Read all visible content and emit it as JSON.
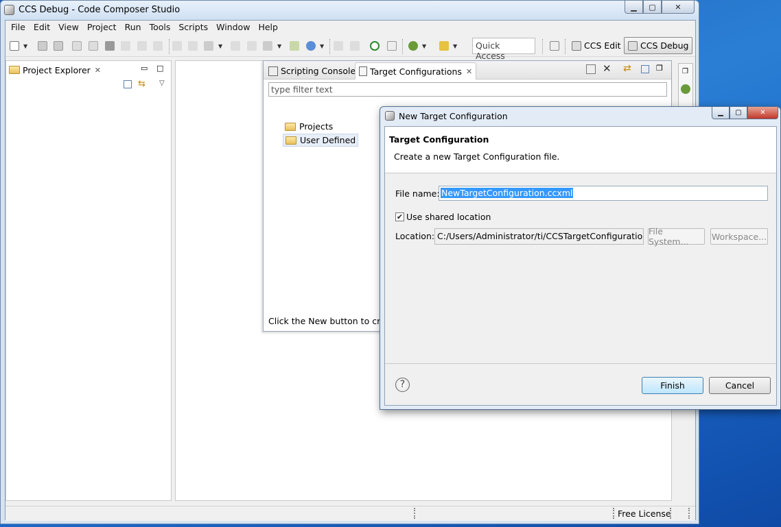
{
  "window": {
    "title": "CCS Debug - Code Composer Studio"
  },
  "menu": [
    "File",
    "Edit",
    "View",
    "Project",
    "Run",
    "Tools",
    "Scripts",
    "Window",
    "Help"
  ],
  "toolbar": {
    "quick_access_placeholder": "Quick Access",
    "perspective_edit": "CCS Edit",
    "perspective_debug": "CCS Debug"
  },
  "project_explorer": {
    "tab_label": "Project Explorer"
  },
  "target_config_panel": {
    "tab_scripting": "Scripting Console",
    "tab_target": "Target Configurations",
    "filter_placeholder": "type filter text",
    "tree": [
      "Projects",
      "User Defined"
    ],
    "hint": "Click the New button to crea"
  },
  "status": {
    "license": "Free License"
  },
  "dialog": {
    "title": "New Target Configuration",
    "header_title": "Target Configuration",
    "header_desc": "Create a new Target Configuration file.",
    "file_name_label": "File name:",
    "file_name_value": "NewTargetConfiguration.ccxml",
    "shared_location_label": "Use shared location",
    "shared_location_checked": true,
    "location_label": "Location:",
    "location_value": "C:/Users/Administrator/ti/CCSTargetConfigurations",
    "file_system_button": "File System...",
    "workspace_button": "Workspace...",
    "finish_button": "Finish",
    "cancel_button": "Cancel"
  },
  "colors": {
    "desktop": "#1d5fb8",
    "dialog_frame": "#e3ecf6",
    "selection": "#3399ff"
  }
}
